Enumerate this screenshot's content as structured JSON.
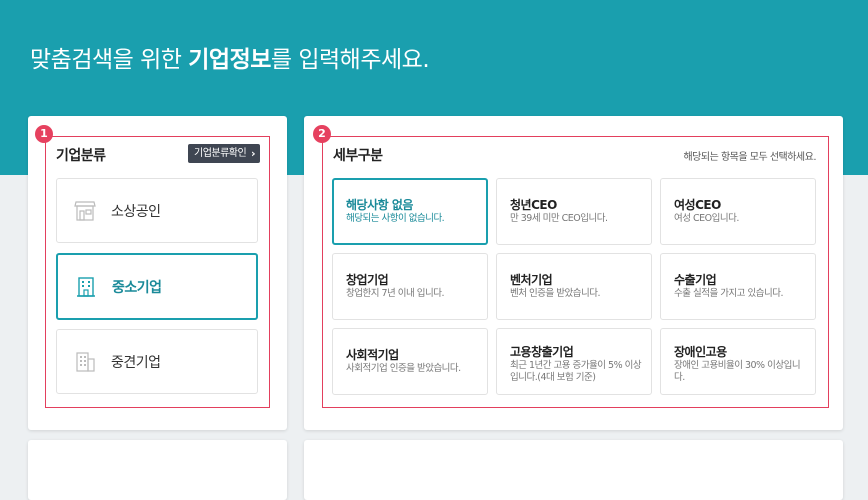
{
  "hero": {
    "title_pre": "맞춤검색을 위한 ",
    "title_bold": "기업정보",
    "title_post": "를 입력해주세요."
  },
  "colors": {
    "primary": "#1a9fae",
    "highlight": "#e33f5d",
    "dark_button": "#3f4652"
  },
  "section1": {
    "badge": "1",
    "title": "기업분류",
    "confirm_button": "기업분류확인",
    "confirm_icon": "chevron-right-icon",
    "items": [
      {
        "label": "소상공인",
        "icon": "shop-icon",
        "selected": false
      },
      {
        "label": "중소기업",
        "icon": "building-icon",
        "selected": true
      },
      {
        "label": "중견기업",
        "icon": "building-icon",
        "selected": false
      }
    ]
  },
  "section2": {
    "badge": "2",
    "title": "세부구분",
    "hint": "해당되는 항목을 모두 선택하세요.",
    "options": [
      {
        "title": "해당사항 없음",
        "desc": "해당되는 사항이 없습니다.",
        "selected": true
      },
      {
        "title": "청년CEO",
        "desc": "만 39세 미만 CEO입니다.",
        "selected": false
      },
      {
        "title": "여성CEO",
        "desc": "여성 CEO입니다.",
        "selected": false
      },
      {
        "title": "창업기업",
        "desc": "창업한지 7년 이내 입니다.",
        "selected": false
      },
      {
        "title": "벤처기업",
        "desc": "벤처 인증을 받았습니다.",
        "selected": false
      },
      {
        "title": "수출기업",
        "desc": "수출 실적을 가지고 있습니다.",
        "selected": false
      },
      {
        "title": "사회적기업",
        "desc": "사회적기업 인증을 받았습니다.",
        "selected": false
      },
      {
        "title": "고용창출기업",
        "desc": "최근 1년간 고용 증가율이 5% 이상입니다.(4대 보험 기준)",
        "selected": false
      },
      {
        "title": "장애인고용",
        "desc": "장애인 고용비율이 30% 이상입니다.",
        "selected": false
      }
    ]
  }
}
